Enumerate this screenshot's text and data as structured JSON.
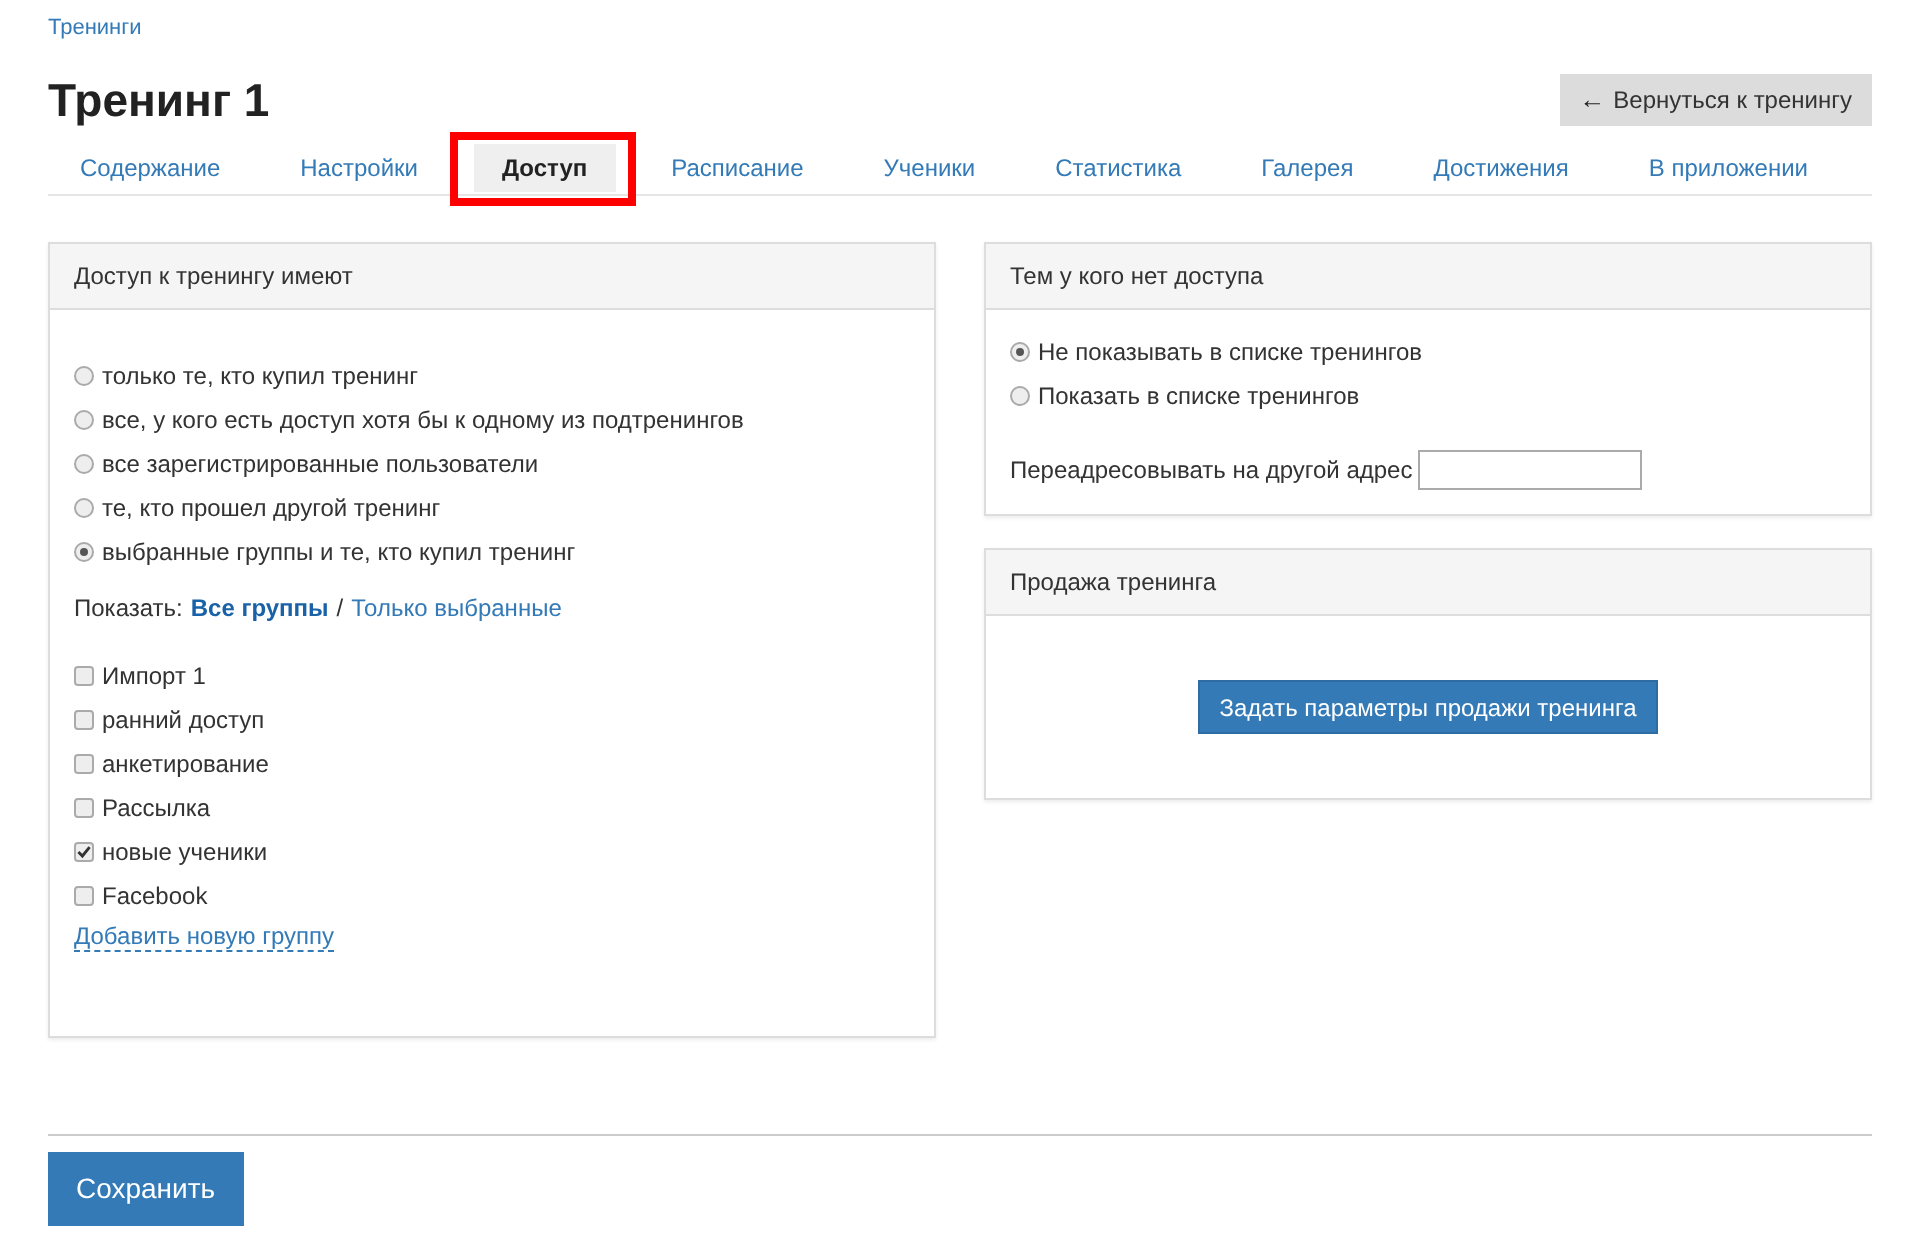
{
  "breadcrumb": "Тренинги",
  "title": "Тренинг 1",
  "back_button": {
    "icon": "←",
    "label": "Вернуться к тренингу"
  },
  "tabs": [
    {
      "label": "Содержание",
      "selected": false,
      "highlighted": false
    },
    {
      "label": "Настройки",
      "selected": false,
      "highlighted": false
    },
    {
      "label": "Доступ",
      "selected": true,
      "highlighted": true
    },
    {
      "label": "Расписание",
      "selected": false,
      "highlighted": false
    },
    {
      "label": "Ученики",
      "selected": false,
      "highlighted": false
    },
    {
      "label": "Статистика",
      "selected": false,
      "highlighted": false
    },
    {
      "label": "Галерея",
      "selected": false,
      "highlighted": false
    },
    {
      "label": "Достижения",
      "selected": false,
      "highlighted": false
    },
    {
      "label": "В приложении",
      "selected": false,
      "highlighted": false
    }
  ],
  "access_panel": {
    "title": "Доступ к тренингу имеют",
    "options": [
      {
        "label": "только те, кто купил тренинг",
        "selected": false
      },
      {
        "label": "все, у кого есть доступ хотя бы к одному из подтренингов",
        "selected": false
      },
      {
        "label": "все зарегистрированные пользователи",
        "selected": false
      },
      {
        "label": "те, кто прошел другой тренинг",
        "selected": false
      },
      {
        "label": "выбранные группы и те, кто купил тренинг",
        "selected": true
      }
    ],
    "show_filter": {
      "label": "Показать:",
      "separator": "/",
      "options": [
        {
          "label": "Все группы",
          "selected": true
        },
        {
          "label": "Только выбранные",
          "selected": false
        }
      ]
    },
    "groups": [
      {
        "label": "Импорт 1",
        "checked": false
      },
      {
        "label": "ранний доступ",
        "checked": false
      },
      {
        "label": "анкетирование",
        "checked": false
      },
      {
        "label": "Рассылка",
        "checked": false
      },
      {
        "label": "новые ученики",
        "checked": true
      },
      {
        "label": "Facebook",
        "checked": false
      }
    ],
    "add_group_link": "Добавить новую группу"
  },
  "no_access_panel": {
    "title": "Тем у кого нет доступа",
    "options": [
      {
        "label": "Не показывать в списке тренингов",
        "selected": true
      },
      {
        "label": "Показать в списке тренингов",
        "selected": false
      }
    ],
    "redirect_label": "Переадресовывать на другой адрес"
  },
  "sale_panel": {
    "title": "Продажа тренинга",
    "button": "Задать параметры продажи тренинга"
  },
  "save_button": "Сохранить"
}
